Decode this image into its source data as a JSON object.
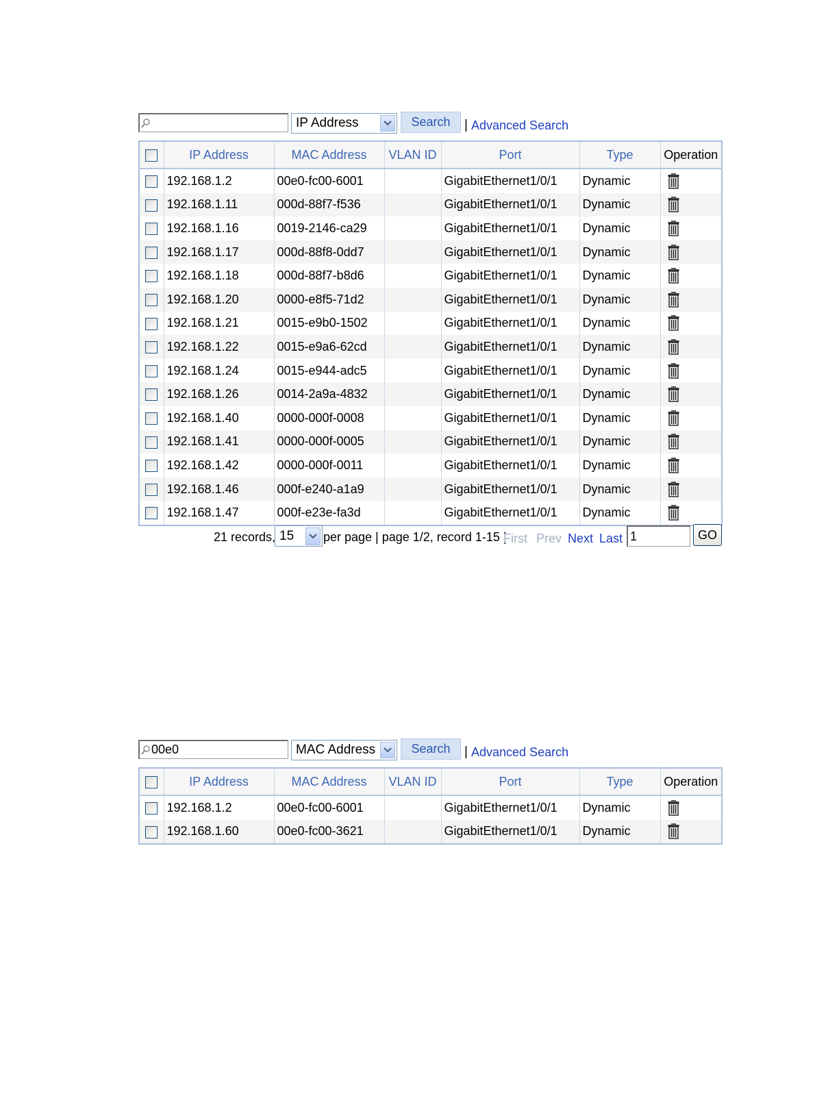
{
  "panel1": {
    "search": {
      "value": "",
      "field": "IP Address",
      "button": "Search",
      "separator": "|",
      "advanced": "Advanced Search"
    },
    "columns": [
      "IP Address",
      "MAC Address",
      "VLAN ID",
      "Port",
      "Type",
      "Operation"
    ],
    "rows": [
      {
        "ip": "192.168.1.2",
        "mac": "00e0-fc00-6001",
        "vlan": "",
        "port": "GigabitEthernet1/0/1",
        "type": "Dynamic"
      },
      {
        "ip": "192.168.1.11",
        "mac": "000d-88f7-f536",
        "vlan": "",
        "port": "GigabitEthernet1/0/1",
        "type": "Dynamic"
      },
      {
        "ip": "192.168.1.16",
        "mac": "0019-2146-ca29",
        "vlan": "",
        "port": "GigabitEthernet1/0/1",
        "type": "Dynamic"
      },
      {
        "ip": "192.168.1.17",
        "mac": "000d-88f8-0dd7",
        "vlan": "",
        "port": "GigabitEthernet1/0/1",
        "type": "Dynamic"
      },
      {
        "ip": "192.168.1.18",
        "mac": "000d-88f7-b8d6",
        "vlan": "",
        "port": "GigabitEthernet1/0/1",
        "type": "Dynamic"
      },
      {
        "ip": "192.168.1.20",
        "mac": "0000-e8f5-71d2",
        "vlan": "",
        "port": "GigabitEthernet1/0/1",
        "type": "Dynamic"
      },
      {
        "ip": "192.168.1.21",
        "mac": "0015-e9b0-1502",
        "vlan": "",
        "port": "GigabitEthernet1/0/1",
        "type": "Dynamic"
      },
      {
        "ip": "192.168.1.22",
        "mac": "0015-e9a6-62cd",
        "vlan": "",
        "port": "GigabitEthernet1/0/1",
        "type": "Dynamic"
      },
      {
        "ip": "192.168.1.24",
        "mac": "0015-e944-adc5",
        "vlan": "",
        "port": "GigabitEthernet1/0/1",
        "type": "Dynamic"
      },
      {
        "ip": "192.168.1.26",
        "mac": "0014-2a9a-4832",
        "vlan": "",
        "port": "GigabitEthernet1/0/1",
        "type": "Dynamic"
      },
      {
        "ip": "192.168.1.40",
        "mac": "0000-000f-0008",
        "vlan": "",
        "port": "GigabitEthernet1/0/1",
        "type": "Dynamic"
      },
      {
        "ip": "192.168.1.41",
        "mac": "0000-000f-0005",
        "vlan": "",
        "port": "GigabitEthernet1/0/1",
        "type": "Dynamic"
      },
      {
        "ip": "192.168.1.42",
        "mac": "0000-000f-0011",
        "vlan": "",
        "port": "GigabitEthernet1/0/1",
        "type": "Dynamic"
      },
      {
        "ip": "192.168.1.46",
        "mac": "000f-e240-a1a9",
        "vlan": "",
        "port": "GigabitEthernet1/0/1",
        "type": "Dynamic"
      },
      {
        "ip": "192.168.1.47",
        "mac": "000f-e23e-fa3d",
        "vlan": "",
        "port": "GigabitEthernet1/0/1",
        "type": "Dynamic"
      }
    ],
    "pager": {
      "records": "21 records,",
      "per_page": "15",
      "info": "per page | page 1/2, record 1-15 |",
      "first": "First",
      "prev": "Prev",
      "next": "Next",
      "last": "Last",
      "page_input": "1",
      "go": "GO"
    }
  },
  "panel2": {
    "search": {
      "value": "00e0",
      "field": "MAC Address",
      "button": "Search",
      "separator": "|",
      "advanced": "Advanced Search"
    },
    "columns": [
      "IP Address",
      "MAC Address",
      "VLAN ID",
      "Port",
      "Type",
      "Operation"
    ],
    "rows": [
      {
        "ip": "192.168.1.2",
        "mac": "00e0-fc00-6001",
        "vlan": "",
        "port": "GigabitEthernet1/0/1",
        "type": "Dynamic"
      },
      {
        "ip": "192.168.1.60",
        "mac": "00e0-fc00-3621",
        "vlan": "",
        "port": "GigabitEthernet1/0/1",
        "type": "Dynamic"
      }
    ]
  },
  "icons": {
    "search": "magnifier-icon",
    "dropdown": "chevron-down-icon",
    "delete": "trash-icon",
    "checkbox": "checkbox-icon"
  },
  "colors": {
    "header_text": "#3d68b7",
    "link": "#1f3fbf",
    "table_border": "#a9bedd",
    "disabled_link": "#a8b1c4"
  }
}
